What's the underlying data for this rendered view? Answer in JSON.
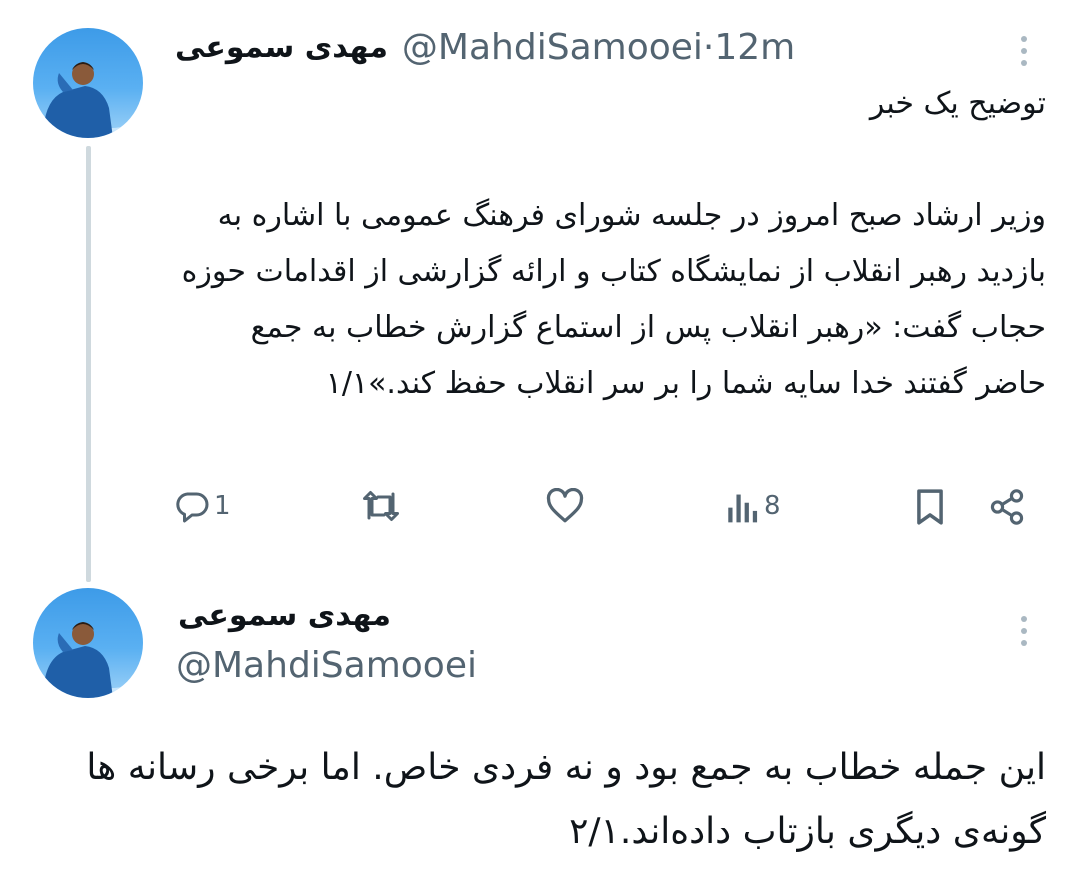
{
  "tweet1": {
    "display_name": "مهدی سموعی",
    "handle": "@MahdiSamooei",
    "time_sep": " · ",
    "time": "12m",
    "body": "توضیح یک خبر\n\nوزیر ارشاد صبح امروز در جلسه شورای فرهنگ عمومی با اشاره به بازدید رهبر انقلاب از نمایشگاه کتاب و ارائه گزارشی از اقدامات حوزه حجاب گفت: «رهبر انقلاب پس از استماع گزارش خطاب به جمع حاضر گفتند خدا سایه شما را بر سر انقلاب حفظ کند.»۱/۱",
    "actions": {
      "replies": "1",
      "retweets": "",
      "likes": "",
      "views": "8"
    }
  },
  "tweet2": {
    "display_name": "مهدی سموعی",
    "handle": "@MahdiSamooei",
    "body": "این جمله خطاب به جمع بود و نه فردی خاص. اما برخی رسانه ها  گونه‌ی دیگری بازتاب داده‌اند.۲/۱"
  },
  "icons": {
    "reply": "reply-icon",
    "retweet": "retweet-icon",
    "like": "heart-icon",
    "views": "views-icon",
    "bookmark": "bookmark-icon",
    "share": "share-icon",
    "more": "more-icon"
  },
  "colors": {
    "text": "#0f1419",
    "secondary": "#536471",
    "thread_line": "#cfd9de"
  }
}
